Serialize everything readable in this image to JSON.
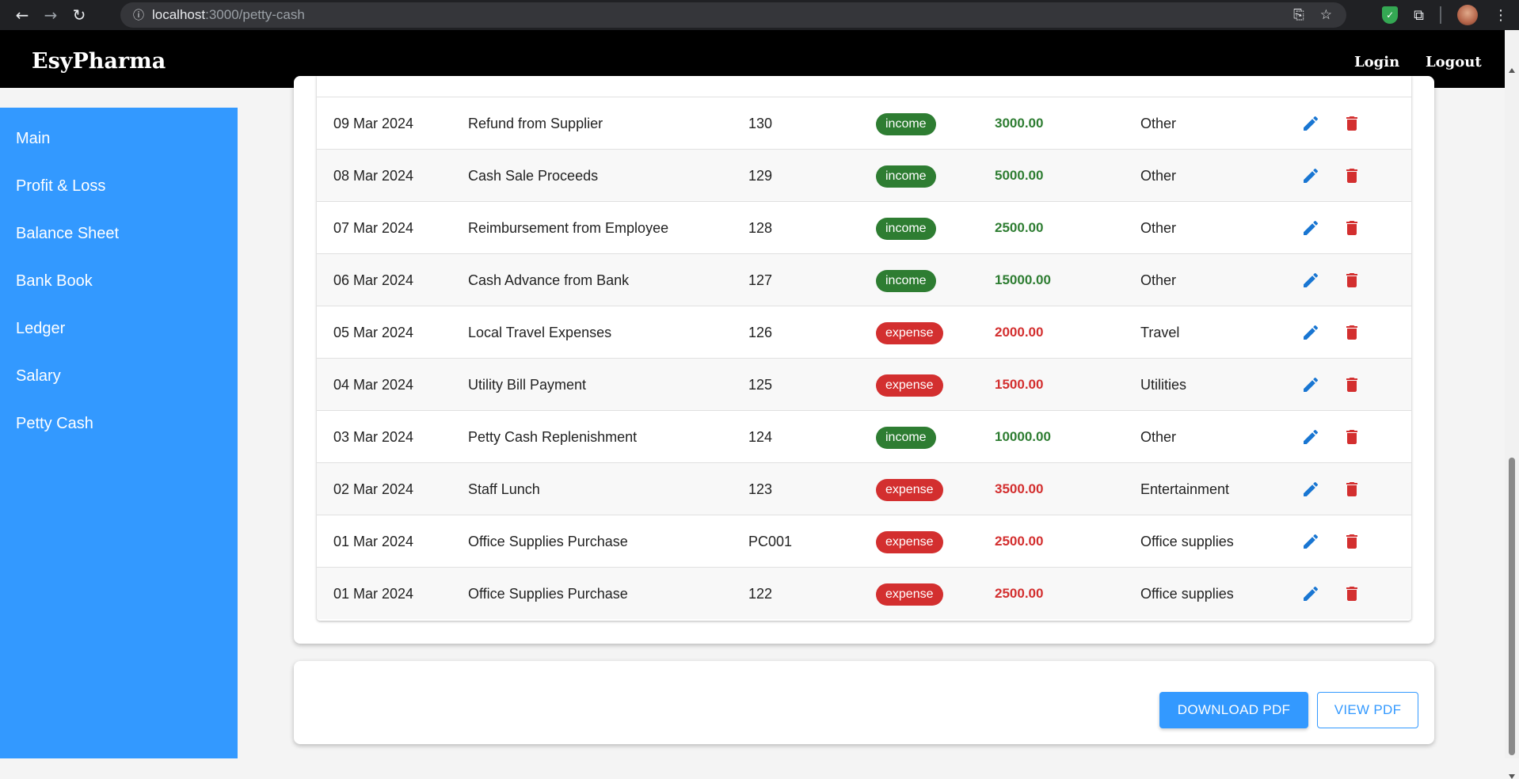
{
  "browser": {
    "url_host": "localhost",
    "url_path": ":3000/petty-cash"
  },
  "header": {
    "brand": "EsyPharma",
    "login": "Login",
    "logout": "Logout"
  },
  "sidebar": {
    "items": [
      {
        "label": "Main"
      },
      {
        "label": "Profit & Loss"
      },
      {
        "label": "Balance Sheet"
      },
      {
        "label": "Bank Book"
      },
      {
        "label": "Ledger"
      },
      {
        "label": "Salary"
      },
      {
        "label": "Petty Cash"
      }
    ]
  },
  "table": {
    "rows": [
      {
        "date": "09 Mar 2024",
        "description": "Refund from Supplier",
        "ref": "130",
        "type": "income",
        "amount": "3000.00",
        "category": "Other"
      },
      {
        "date": "08 Mar 2024",
        "description": "Cash Sale Proceeds",
        "ref": "129",
        "type": "income",
        "amount": "5000.00",
        "category": "Other"
      },
      {
        "date": "07 Mar 2024",
        "description": "Reimbursement from Employee",
        "ref": "128",
        "type": "income",
        "amount": "2500.00",
        "category": "Other"
      },
      {
        "date": "06 Mar 2024",
        "description": "Cash Advance from Bank",
        "ref": "127",
        "type": "income",
        "amount": "15000.00",
        "category": "Other"
      },
      {
        "date": "05 Mar 2024",
        "description": "Local Travel Expenses",
        "ref": "126",
        "type": "expense",
        "amount": "2000.00",
        "category": "Travel"
      },
      {
        "date": "04 Mar 2024",
        "description": "Utility Bill Payment",
        "ref": "125",
        "type": "expense",
        "amount": "1500.00",
        "category": "Utilities"
      },
      {
        "date": "03 Mar 2024",
        "description": "Petty Cash Replenishment",
        "ref": "124",
        "type": "income",
        "amount": "10000.00",
        "category": "Other"
      },
      {
        "date": "02 Mar 2024",
        "description": "Staff Lunch",
        "ref": "123",
        "type": "expense",
        "amount": "3500.00",
        "category": "Entertainment"
      },
      {
        "date": "01 Mar 2024",
        "description": "Office Supplies Purchase",
        "ref": "PC001",
        "type": "expense",
        "amount": "2500.00",
        "category": "Office supplies"
      },
      {
        "date": "01 Mar 2024",
        "description": "Office Supplies Purchase",
        "ref": "122",
        "type": "expense",
        "amount": "2500.00",
        "category": "Office supplies"
      }
    ]
  },
  "actions": {
    "download_pdf": "DOWNLOAD PDF",
    "view_pdf": "VIEW PDF"
  },
  "colors": {
    "accent": "#3399ff",
    "income": "#2e7d32",
    "expense": "#d32f2f",
    "edit_icon": "#1976d2"
  },
  "icons": {
    "row_edit": "pencil-icon",
    "row_delete": "trash-icon"
  }
}
